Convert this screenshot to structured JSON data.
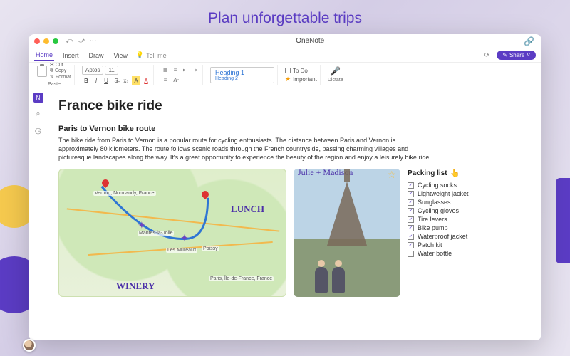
{
  "hero": "Plan unforgettable trips",
  "app_title": "OneNote",
  "tabs": {
    "home": "Home",
    "insert": "Insert",
    "draw": "Draw",
    "view": "View",
    "tell_me": "Tell me"
  },
  "share_label": "Share",
  "ribbon": {
    "paste": "Paste",
    "cut": "Cut",
    "copy": "Copy",
    "format": "Format",
    "font_name": "Aptos",
    "font_size": "11",
    "heading1": "Heading 1",
    "heading2": "Heading 2",
    "todo": "To Do",
    "important": "Important",
    "dictate": "Dictate"
  },
  "page": {
    "title": "France bike ride",
    "subtitle": "Paris to Vernon bike route",
    "body": "The bike ride from Paris to Vernon is a popular route for cycling enthusiasts. The distance between Paris and Vernon is approximately 80 kilometers. The route follows scenic roads through the French countryside, passing charming villages and picturesque landscapes along the way. It's a great opportunity to experience the beauty of the region and enjoy a leisurely bike ride."
  },
  "map": {
    "label_vernon": "Vernon, Normandy, France",
    "label_mantes": "Mantes-la-Jolie",
    "label_mureaux": "Les Mureaux",
    "label_poissy": "Poissy",
    "label_paris": "Paris, Île-de-France, France",
    "hand_lunch": "LUNCH",
    "hand_winery": "WINERY"
  },
  "photo_caption": "Julie + Madison",
  "packing": {
    "title": "Packing list",
    "items": [
      {
        "label": "Cycling socks",
        "checked": true
      },
      {
        "label": "Lightweight jacket",
        "checked": true
      },
      {
        "label": "Sunglasses",
        "checked": true
      },
      {
        "label": "Cycling gloves",
        "checked": true
      },
      {
        "label": "Tire levers",
        "checked": true
      },
      {
        "label": "Bike pump",
        "checked": true
      },
      {
        "label": "Waterproof jacket",
        "checked": true
      },
      {
        "label": "Patch kit",
        "checked": true
      },
      {
        "label": "Water bottle",
        "checked": false
      }
    ]
  }
}
